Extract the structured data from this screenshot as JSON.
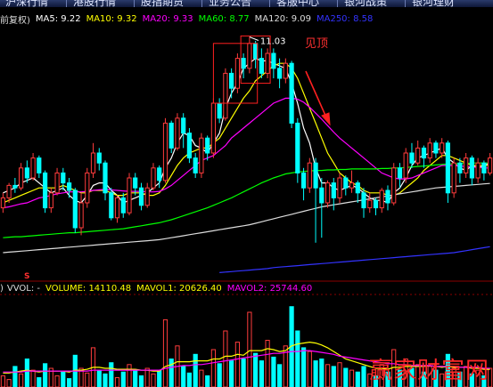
{
  "nav": {
    "tabs": [
      "沪深行情",
      "港股行情",
      "股指期货",
      "业务公告",
      "客服中心",
      "银河战策",
      "银河理财"
    ]
  },
  "price_panel": {
    "adjust_label": "前复权)",
    "ma_items": [
      {
        "label": "MA5: 9.22",
        "color": "#ffffff"
      },
      {
        "label": "MA10: 9.32",
        "color": "#ffff00"
      },
      {
        "label": "MA20: 9.33",
        "color": "#ff00ff"
      },
      {
        "label": "MA60: 8.77",
        "color": "#00ff00"
      },
      {
        "label": "MA120: 9.09",
        "color": "#dddddd"
      },
      {
        "label": "MA250: 8.58",
        "color": "#3333ff"
      }
    ],
    "annotation": "见顶"
  },
  "volume_panel": {
    "prefix": ")",
    "name": "VVOL: -",
    "items": [
      {
        "label": "VOLUME: 14110.48",
        "color": "#ffff00"
      },
      {
        "label": "MAVOL1: 20626.40",
        "color": "#ffff00"
      },
      {
        "label": "MAVOL2: 25744.60",
        "color": "#ff00ff"
      }
    ],
    "marker": "S"
  },
  "watermark": "赢家财富网",
  "colors": {
    "up": "#ff3c3c",
    "down": "#00ffff",
    "background": "#000000",
    "grid": "#8b0000"
  },
  "chart_data": [
    {
      "type": "candlestick",
      "title": "",
      "ylabel": "",
      "high_label": "11.03",
      "ylim": [
        6.2,
        11.2
      ],
      "series": [
        {
          "name": "MA5",
          "value": 9.22
        },
        {
          "name": "MA10",
          "value": 9.32
        },
        {
          "name": "MA20",
          "value": 9.33
        },
        {
          "name": "MA60",
          "value": 8.77
        },
        {
          "name": "MA120",
          "value": 9.09
        },
        {
          "name": "MA250",
          "value": 8.58
        }
      ],
      "candles": [
        [
          7.6,
          7.8,
          7.9,
          7.5
        ],
        [
          7.8,
          8.05,
          8.1,
          7.7
        ],
        [
          8.05,
          8.0,
          8.2,
          7.9
        ],
        [
          8.0,
          8.4,
          8.5,
          7.95
        ],
        [
          8.4,
          8.2,
          8.55,
          8.1
        ],
        [
          8.2,
          8.6,
          8.7,
          8.15
        ],
        [
          8.6,
          8.3,
          8.65,
          8.2
        ],
        [
          8.3,
          7.6,
          8.35,
          7.5
        ],
        [
          7.6,
          7.9,
          8.0,
          7.5
        ],
        [
          7.9,
          8.3,
          8.4,
          7.85
        ],
        [
          8.3,
          8.1,
          8.4,
          7.95
        ],
        [
          8.1,
          7.95,
          8.2,
          7.8
        ],
        [
          7.95,
          7.2,
          8.0,
          7.1
        ],
        [
          7.2,
          7.7,
          7.9,
          7.05
        ],
        [
          7.7,
          8.3,
          8.4,
          7.6
        ],
        [
          8.3,
          8.7,
          8.9,
          8.2
        ],
        [
          8.7,
          8.5,
          8.8,
          8.35
        ],
        [
          8.5,
          7.9,
          8.55,
          7.75
        ],
        [
          7.9,
          7.4,
          8.0,
          7.35
        ],
        [
          7.4,
          7.8,
          7.85,
          7.3
        ],
        [
          7.8,
          7.5,
          7.9,
          7.4
        ],
        [
          7.5,
          8.2,
          8.3,
          7.45
        ],
        [
          8.2,
          8.0,
          8.3,
          7.85
        ],
        [
          8.0,
          7.65,
          8.1,
          7.55
        ],
        [
          7.65,
          8.0,
          8.1,
          7.6
        ],
        [
          8.0,
          8.4,
          8.5,
          7.95
        ],
        [
          8.4,
          8.15,
          8.45,
          8.0
        ],
        [
          8.15,
          9.3,
          9.4,
          8.1
        ],
        [
          9.3,
          8.8,
          9.35,
          8.7
        ],
        [
          8.8,
          9.4,
          9.5,
          8.75
        ],
        [
          9.4,
          9.1,
          9.5,
          8.8
        ],
        [
          9.1,
          8.6,
          9.2,
          8.5
        ],
        [
          8.6,
          8.3,
          8.7,
          8.2
        ],
        [
          8.3,
          9.0,
          9.1,
          8.2
        ],
        [
          9.0,
          8.7,
          9.05,
          8.55
        ],
        [
          8.7,
          9.7,
          9.8,
          8.6
        ],
        [
          9.7,
          9.4,
          9.8,
          9.3
        ],
        [
          9.4,
          10.3,
          10.4,
          9.35
        ],
        [
          10.3,
          10.0,
          10.4,
          9.8
        ],
        [
          10.0,
          10.6,
          10.7,
          9.9
        ],
        [
          10.6,
          10.4,
          10.7,
          10.2
        ],
        [
          10.4,
          10.9,
          11.03,
          10.3
        ],
        [
          10.9,
          10.6,
          10.95,
          10.4
        ],
        [
          10.6,
          10.3,
          10.8,
          10.2
        ],
        [
          10.3,
          10.7,
          10.8,
          10.2
        ],
        [
          10.7,
          10.4,
          10.8,
          10.2
        ],
        [
          10.4,
          10.2,
          10.6,
          10.0
        ],
        [
          10.2,
          10.5,
          10.6,
          10.1
        ],
        [
          10.5,
          9.3,
          10.55,
          9.2
        ],
        [
          9.3,
          8.3,
          9.4,
          8.1
        ],
        [
          8.3,
          8.0,
          8.4,
          7.75
        ],
        [
          8.0,
          8.5,
          8.6,
          7.9
        ],
        [
          8.5,
          8.0,
          8.6,
          6.9
        ],
        [
          8.0,
          7.7,
          8.2,
          7.0
        ],
        [
          7.7,
          8.1,
          8.15,
          7.6
        ],
        [
          8.1,
          7.8,
          8.2,
          7.55
        ],
        [
          7.8,
          8.2,
          8.3,
          7.7
        ],
        [
          8.2,
          8.0,
          8.25,
          7.85
        ],
        [
          8.0,
          8.1,
          8.35,
          7.9
        ],
        [
          8.1,
          7.9,
          8.15,
          7.7
        ],
        [
          7.9,
          7.6,
          8.0,
          7.4
        ],
        [
          7.6,
          7.75,
          7.9,
          7.5
        ],
        [
          7.75,
          7.6,
          7.8,
          7.45
        ],
        [
          7.6,
          7.95,
          8.0,
          7.5
        ],
        [
          7.95,
          7.7,
          8.05,
          7.55
        ],
        [
          7.7,
          8.4,
          8.5,
          7.65
        ],
        [
          8.4,
          8.2,
          8.5,
          8.0
        ],
        [
          8.2,
          8.7,
          8.8,
          8.1
        ],
        [
          8.7,
          8.5,
          8.9,
          8.4
        ],
        [
          8.5,
          8.8,
          8.95,
          8.45
        ],
        [
          8.8,
          8.6,
          8.85,
          8.4
        ],
        [
          8.6,
          8.9,
          9.0,
          8.5
        ],
        [
          8.9,
          8.7,
          8.95,
          8.6
        ],
        [
          8.7,
          8.9,
          9.0,
          8.6
        ],
        [
          8.9,
          7.9,
          8.95,
          7.7
        ],
        [
          7.9,
          8.5,
          8.6,
          7.8
        ],
        [
          8.5,
          8.3,
          8.6,
          8.1
        ],
        [
          8.3,
          8.6,
          8.7,
          8.2
        ],
        [
          8.6,
          8.2,
          8.65,
          8.05
        ],
        [
          8.2,
          8.5,
          8.6,
          8.1
        ],
        [
          8.5,
          8.3,
          8.55,
          8.15
        ],
        [
          8.3,
          8.6,
          8.7,
          8.25
        ]
      ],
      "ma": {
        "MA5": [
          7.9,
          7.95,
          8.0,
          8.1,
          8.15,
          8.2,
          8.1,
          8.0,
          7.9,
          7.95,
          8.0,
          7.85,
          7.75,
          7.7,
          7.85,
          8.05,
          8.1,
          8.1,
          7.95,
          7.85,
          7.7,
          7.75,
          7.8,
          7.85,
          7.9,
          8.0,
          8.1,
          8.4,
          8.6,
          8.9,
          9.1,
          9.05,
          8.85,
          8.8,
          8.7,
          8.9,
          9.1,
          9.6,
          9.9,
          10.1,
          10.4,
          10.5,
          10.6,
          10.55,
          10.55,
          10.5,
          10.45,
          10.4,
          10.1,
          9.7,
          9.2,
          8.9,
          8.4,
          8.1,
          8.1,
          8.0,
          7.95,
          8.0,
          8.05,
          8.0,
          7.9,
          7.8,
          7.75,
          7.75,
          7.7,
          7.9,
          8.0,
          8.2,
          8.45,
          8.6,
          8.65,
          8.7,
          8.75,
          8.8,
          8.6,
          8.5,
          8.4,
          8.35,
          8.45,
          8.4,
          8.45,
          8.5
        ],
        "MA10": [
          7.7,
          7.75,
          7.8,
          7.85,
          7.9,
          7.95,
          8.0,
          8.0,
          8.0,
          8.0,
          8.05,
          8.0,
          7.95,
          7.9,
          7.9,
          7.95,
          7.95,
          7.95,
          7.9,
          7.85,
          7.85,
          7.9,
          7.9,
          7.9,
          7.85,
          7.85,
          7.9,
          8.05,
          8.25,
          8.45,
          8.6,
          8.7,
          8.75,
          8.8,
          8.8,
          8.9,
          9.0,
          9.2,
          9.4,
          9.6,
          9.8,
          9.95,
          10.15,
          10.25,
          10.35,
          10.45,
          10.5,
          10.5,
          10.4,
          10.2,
          9.9,
          9.6,
          9.3,
          9.0,
          8.7,
          8.5,
          8.3,
          8.2,
          8.1,
          8.05,
          7.95,
          7.9,
          7.9,
          7.9,
          7.85,
          7.85,
          7.9,
          8.0,
          8.1,
          8.2,
          8.35,
          8.45,
          8.55,
          8.65,
          8.65,
          8.6,
          8.55,
          8.5,
          8.45,
          8.45,
          8.45,
          8.45
        ],
        "MA20": [
          7.6,
          7.62,
          7.65,
          7.68,
          7.7,
          7.75,
          7.8,
          7.82,
          7.85,
          7.88,
          7.9,
          7.92,
          7.92,
          7.92,
          7.93,
          7.95,
          7.96,
          7.97,
          7.96,
          7.95,
          7.94,
          7.93,
          7.93,
          7.93,
          7.92,
          7.92,
          7.93,
          7.98,
          8.05,
          8.15,
          8.25,
          8.35,
          8.45,
          8.55,
          8.6,
          8.65,
          8.75,
          8.85,
          9.0,
          9.1,
          9.2,
          9.3,
          9.4,
          9.5,
          9.6,
          9.7,
          9.75,
          9.8,
          9.8,
          9.78,
          9.72,
          9.62,
          9.5,
          9.38,
          9.25,
          9.12,
          9.0,
          8.9,
          8.8,
          8.7,
          8.6,
          8.5,
          8.4,
          8.3,
          8.25,
          8.2,
          8.18,
          8.18,
          8.2,
          8.25,
          8.3,
          8.35,
          8.4,
          8.45,
          8.45,
          8.45,
          8.44,
          8.43,
          8.42,
          8.41,
          8.4,
          8.4
        ],
        "MA60": [
          7.0,
          7.01,
          7.02,
          7.02,
          7.03,
          7.04,
          7.05,
          7.06,
          7.07,
          7.08,
          7.09,
          7.1,
          7.1,
          7.11,
          7.12,
          7.13,
          7.14,
          7.15,
          7.16,
          7.17,
          7.18,
          7.2,
          7.22,
          7.24,
          7.26,
          7.28,
          7.3,
          7.33,
          7.36,
          7.4,
          7.44,
          7.48,
          7.52,
          7.56,
          7.6,
          7.65,
          7.7,
          7.75,
          7.8,
          7.86,
          7.92,
          7.98,
          8.04,
          8.1,
          8.15,
          8.2,
          8.24,
          8.28,
          8.3,
          8.32,
          8.33,
          8.34,
          8.35,
          8.35,
          8.36,
          8.36,
          8.37,
          8.37,
          8.38,
          8.38,
          8.38,
          8.38,
          8.38,
          8.39,
          8.39,
          8.4,
          8.4,
          8.41,
          8.42,
          8.43,
          8.44,
          8.45,
          8.46,
          8.47,
          8.48,
          8.48,
          8.49,
          8.49,
          8.5,
          8.5,
          8.5,
          8.5
        ],
        "MA120": [
          6.7,
          6.71,
          6.72,
          6.73,
          6.74,
          6.75,
          6.76,
          6.77,
          6.78,
          6.79,
          6.8,
          6.81,
          6.82,
          6.83,
          6.84,
          6.85,
          6.86,
          6.87,
          6.88,
          6.89,
          6.9,
          6.91,
          6.92,
          6.93,
          6.94,
          6.95,
          6.96,
          6.98,
          7.0,
          7.02,
          7.04,
          7.06,
          7.08,
          7.1,
          7.12,
          7.14,
          7.16,
          7.18,
          7.2,
          7.22,
          7.24,
          7.26,
          7.29,
          7.32,
          7.35,
          7.38,
          7.41,
          7.44,
          7.47,
          7.5,
          7.53,
          7.56,
          7.59,
          7.62,
          7.64,
          7.66,
          7.68,
          7.7,
          7.72,
          7.74,
          7.76,
          7.78,
          7.8,
          7.82,
          7.84,
          7.86,
          7.88,
          7.9,
          7.92,
          7.94,
          7.96,
          7.98,
          8.0,
          8.01,
          8.02,
          8.03,
          8.04,
          8.05,
          8.06,
          8.07,
          8.08,
          8.09
        ],
        "MA250": [
          null,
          null,
          null,
          null,
          null,
          null,
          null,
          null,
          null,
          null,
          null,
          null,
          null,
          null,
          null,
          null,
          null,
          null,
          null,
          null,
          null,
          null,
          null,
          null,
          null,
          null,
          null,
          null,
          null,
          null,
          null,
          null,
          null,
          null,
          null,
          null,
          6.3,
          6.31,
          6.32,
          6.33,
          6.34,
          6.35,
          6.36,
          6.37,
          6.38,
          6.4,
          6.41,
          6.42,
          6.43,
          6.44,
          6.45,
          6.46,
          6.47,
          6.48,
          6.49,
          6.5,
          6.51,
          6.52,
          6.53,
          6.54,
          6.55,
          6.56,
          6.57,
          6.58,
          6.59,
          6.6,
          6.61,
          6.62,
          6.63,
          6.64,
          6.65,
          6.66,
          6.67,
          6.68,
          6.69,
          6.7,
          6.72,
          6.74,
          6.76,
          6.78,
          6.8,
          6.82
        ]
      }
    },
    {
      "type": "bar",
      "title": "",
      "ylabel": "",
      "ylim": [
        0,
        100
      ],
      "series": [
        {
          "name": "VOLUME",
          "value": 14110.48
        },
        {
          "name": "MAVOL1",
          "value": 20626.4
        },
        {
          "name": "MAVOL2",
          "value": 25744.6
        }
      ],
      "volume": [
        12,
        8,
        22,
        14,
        30,
        18,
        10,
        25,
        20,
        12,
        16,
        9,
        34,
        20,
        15,
        42,
        18,
        14,
        26,
        10,
        16,
        24,
        18,
        12,
        20,
        14,
        18,
        72,
        30,
        44,
        22,
        15,
        35,
        18,
        12,
        40,
        25,
        60,
        28,
        48,
        30,
        80,
        36,
        28,
        50,
        32,
        24,
        44,
        86,
        60,
        42,
        38,
        28,
        30,
        24,
        22,
        26,
        20,
        18,
        16,
        22,
        14,
        12,
        24,
        16,
        40,
        18,
        30,
        20,
        24,
        16,
        22,
        18,
        14,
        35,
        20,
        16,
        22,
        14,
        18,
        12,
        20
      ],
      "mavol1": [
        15,
        15,
        16,
        17,
        18,
        17,
        16,
        17,
        17,
        17,
        17,
        16,
        18,
        18,
        19,
        21,
        21,
        20,
        20,
        19,
        19,
        19,
        19,
        18,
        18,
        17,
        17,
        22,
        24,
        27,
        27,
        27,
        28,
        28,
        28,
        30,
        30,
        33,
        33,
        35,
        34,
        39,
        39,
        39,
        41,
        40,
        38,
        39,
        44,
        46,
        47,
        48,
        47,
        45,
        42,
        38,
        34,
        30,
        28,
        26,
        24,
        22,
        20,
        20,
        19,
        21,
        21,
        22,
        22,
        22,
        22,
        23,
        22,
        21,
        22,
        21,
        21,
        21,
        20,
        20,
        19,
        19
      ],
      "mavol2": [
        16,
        16,
        16,
        16,
        17,
        17,
        17,
        17,
        17,
        17,
        17,
        17,
        17,
        17,
        17,
        18,
        18,
        18,
        18,
        18,
        18,
        18,
        18,
        18,
        18,
        18,
        18,
        20,
        21,
        22,
        23,
        23,
        24,
        24,
        25,
        26,
        27,
        28,
        29,
        30,
        31,
        32,
        33,
        34,
        35,
        36,
        36,
        37,
        38,
        38,
        39,
        39,
        38,
        37,
        36,
        35,
        33,
        32,
        31,
        30,
        29,
        28,
        27,
        26,
        25,
        25,
        24,
        24,
        23,
        23,
        23,
        23,
        22,
        22,
        22,
        22,
        21,
        21,
        21,
        21,
        20,
        20
      ]
    }
  ]
}
